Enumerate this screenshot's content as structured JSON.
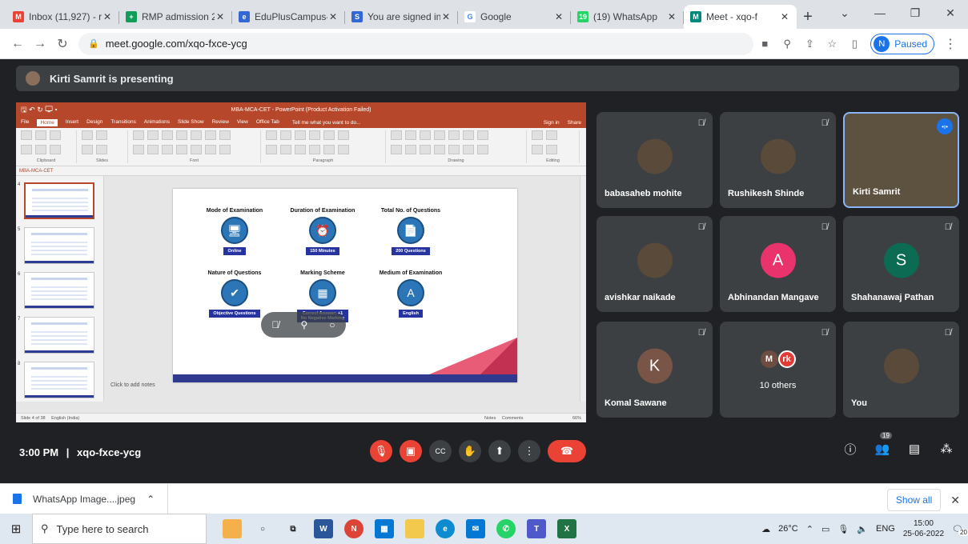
{
  "browser": {
    "tabs": [
      {
        "title": "Inbox (11,927) - r",
        "favicon_color": "#ea4335",
        "favicon": "M"
      },
      {
        "title": "RMP admission 2",
        "favicon_color": "#0f9d58",
        "favicon": "+"
      },
      {
        "title": "EduPlusCampus-",
        "favicon_color": "#3367d6",
        "favicon": "e"
      },
      {
        "title": "You are signed in",
        "favicon_color": "#3367d6",
        "favicon": "S"
      },
      {
        "title": "Google",
        "favicon_color": "#ffffff",
        "favicon": "G"
      },
      {
        "title": "(19) WhatsApp",
        "favicon_color": "#25d366",
        "favicon": "19"
      },
      {
        "title": "Meet - xqo-f",
        "favicon_color": "#00897b",
        "favicon": "M"
      }
    ],
    "url": "meet.google.com/xqo-fxce-ycg",
    "profile_initial": "N",
    "profile_status": "Paused"
  },
  "meet": {
    "presenting_text": "Kirti Samrit is presenting",
    "time": "3:00 PM",
    "separator": "|",
    "meeting_code": "xqo-fxce-ycg",
    "participant_count": "19",
    "participants": [
      {
        "name": "babasaheb mohite",
        "type": "photo"
      },
      {
        "name": "Rushikesh Shinde",
        "type": "photo"
      },
      {
        "name": "Kirti Samrit",
        "type": "video"
      },
      {
        "name": "avishkar naikade",
        "type": "photo"
      },
      {
        "name": "Abhinandan Mangave",
        "type": "letter",
        "letter": "A",
        "color": "#e8336d"
      },
      {
        "name": "Shahanawaj Pathan",
        "type": "letter",
        "letter": "S",
        "color": "#0b6b53"
      },
      {
        "name": "Komal Sawane",
        "type": "letter",
        "letter": "K",
        "color": "#795548"
      },
      {
        "name": "10 others",
        "type": "group",
        "avatars": [
          "M",
          "rk"
        ]
      },
      {
        "name": "You",
        "type": "photo"
      }
    ]
  },
  "ppt": {
    "window_title": "MBA-MCA-CET - PowerPoint (Product Activation Failed)",
    "ribbon_tabs": [
      "File",
      "Home",
      "Insert",
      "Design",
      "Transitions",
      "Animations",
      "Slide Show",
      "Review",
      "View",
      "Office Tab"
    ],
    "tell_me": "Tell me what you want to do...",
    "sign_in": "Sign in",
    "share": "Share",
    "ribbon_groups": [
      "Clipboard",
      "Slides",
      "Font",
      "Paragraph",
      "Drawing",
      "Editing"
    ],
    "doc_tab": "MBA-MCA-CET",
    "notes_placeholder": "Click to add notes",
    "status_left": "Slide 4 of 38",
    "status_lang": "English (India)",
    "status_notes": "Notes",
    "status_comments": "Comments",
    "status_zoom": "66%",
    "thumb_numbers": [
      "4",
      "5",
      "6",
      "7",
      "8"
    ],
    "slide": {
      "items": [
        {
          "header": "Mode of Examination",
          "caption": "Online",
          "icon": "monitor-icon"
        },
        {
          "header": "Duration of Examination",
          "caption": "150 Minutes",
          "icon": "clock-icon"
        },
        {
          "header": "Total No. of Questions",
          "caption": "200 Questions",
          "icon": "document-icon"
        },
        {
          "header": "Nature of Questions",
          "caption": "Objective Questions",
          "icon": "checklist-icon"
        },
        {
          "header": "Marking Scheme",
          "caption": "Correct Answer: +1\nNo Negative Marking",
          "icon": "score-icon"
        },
        {
          "header": "Medium of Examination",
          "caption": "English",
          "icon": "language-icon"
        }
      ]
    }
  },
  "downloads": {
    "file": "WhatsApp Image....jpeg",
    "show_all": "Show all"
  },
  "taskbar": {
    "search_placeholder": "Type here to search",
    "temperature": "26°C",
    "language": "ENG",
    "time": "15:00",
    "date": "25-06-2022",
    "notification_count": "20"
  }
}
